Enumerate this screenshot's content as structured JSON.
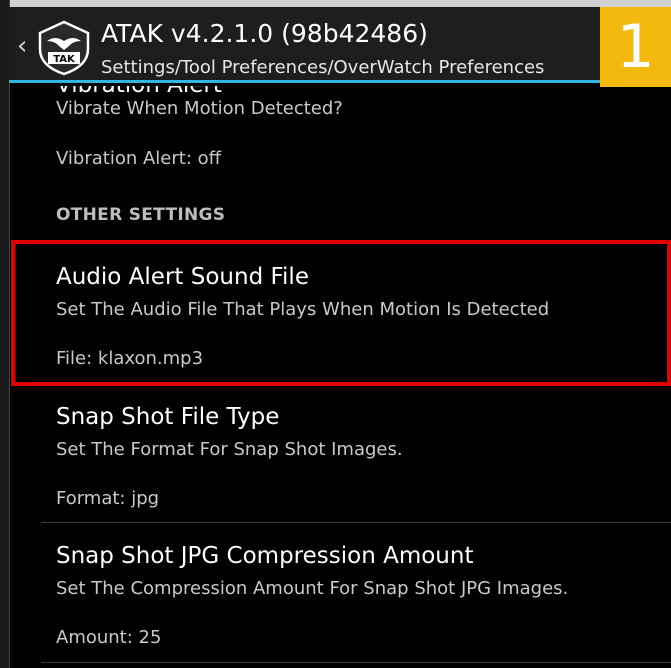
{
  "app": {
    "title": "ATAK v4.2.1.0 (98b42486)",
    "breadcrumb": "Settings/Tool Preferences/OverWatch Preferences",
    "logo_text": "TAK"
  },
  "step_badge": "1",
  "colors": {
    "accent": "#34b6e4",
    "highlight": "#e10000",
    "badge": "#f4b90e"
  },
  "preferences": {
    "vibration_title": "Vibration Alert",
    "vibration_desc": "Vibrate When Motion Detected?",
    "vibration_value": "Vibration Alert: off",
    "category": "OTHER SETTINGS",
    "audio_title": "Audio Alert Sound File",
    "audio_desc": "Set The Audio File That Plays When Motion Is Detected",
    "audio_value": "File: klaxon.mp3",
    "snap_type_title": "Snap Shot File Type",
    "snap_type_desc": "Set The Format For Snap Shot Images.",
    "snap_type_value": "Format: jpg",
    "jpg_title": "Snap Shot JPG Compression Amount",
    "jpg_desc": "Set The Compression Amount For Snap Shot JPG Images.",
    "jpg_value": "Amount: 25"
  }
}
